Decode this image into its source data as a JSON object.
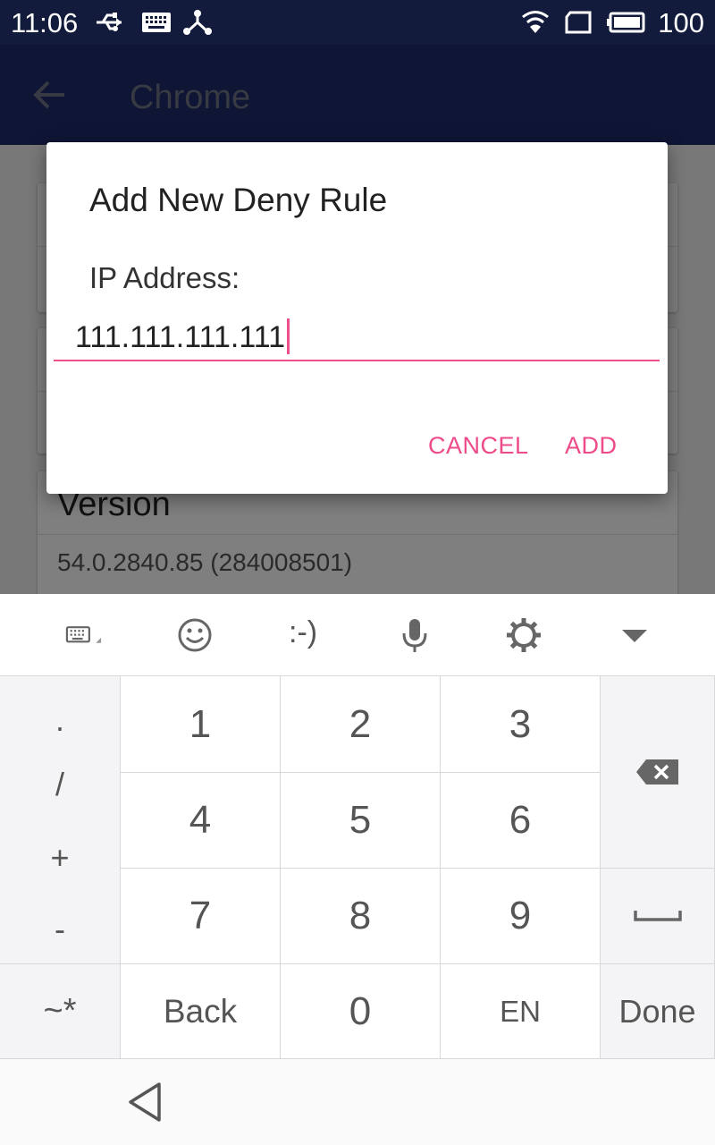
{
  "status_bar": {
    "time": "11:06",
    "battery_level": "100",
    "icons": [
      "usb-icon",
      "keyboard-icon",
      "share-icon",
      "wifi-icon",
      "sim-icon",
      "battery-icon"
    ]
  },
  "app_bar": {
    "title": "Chrome",
    "back_icon": "back-arrow-icon"
  },
  "background": {
    "version_title": "Version",
    "version_value": "54.0.2840.85 (284008501)"
  },
  "dialog": {
    "title": "Add New Deny Rule",
    "label": "IP Address:",
    "input_value": "111.111.111.111",
    "cancel_label": "CANCEL",
    "add_label": "ADD",
    "accent_color": "#ee4b8a"
  },
  "keyboard": {
    "toolbar": {
      "emoticon_text": ":-)",
      "icons": [
        "keyboard-switch-icon",
        "emoji-icon",
        "microphone-icon",
        "settings-icon",
        "hide-keyboard-icon"
      ]
    },
    "symbol_column": [
      ".",
      "/",
      "+",
      "-"
    ],
    "digits": [
      "1",
      "2",
      "3",
      "4",
      "5",
      "6",
      "7",
      "8",
      "9"
    ],
    "bottom_row": {
      "symbols": "~*",
      "back": "Back",
      "zero": "0",
      "language": "EN",
      "done": "Done"
    }
  },
  "nav_bar": {
    "back_icon": "nav-back-icon"
  }
}
